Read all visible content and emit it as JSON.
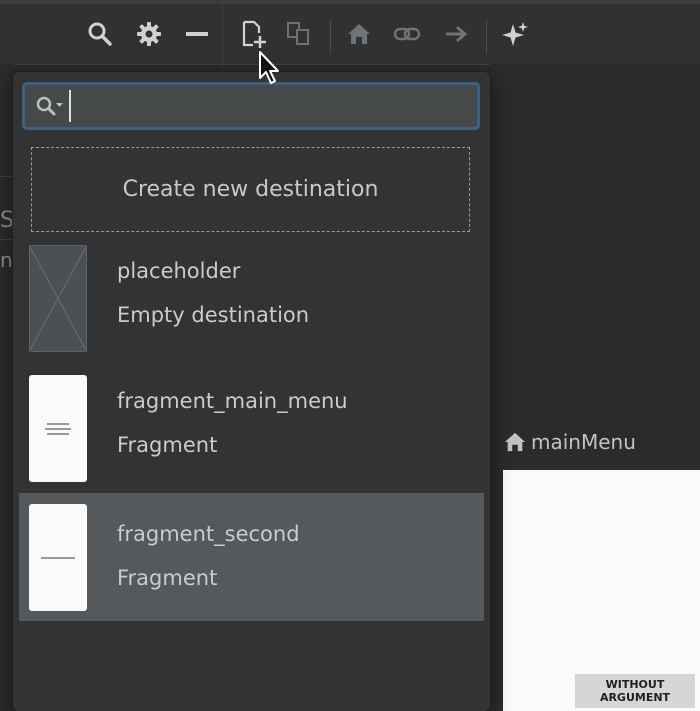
{
  "toolbar": {
    "icons": [
      "search-icon",
      "gear-icon",
      "minus-icon",
      "new-destination-icon",
      "nested-graph-icon",
      "home-icon",
      "link-icon",
      "arrow-right-icon",
      "sparkle-icon"
    ]
  },
  "popup": {
    "search": {
      "value": "",
      "placeholder": ""
    },
    "create_label": "Create new destination",
    "items": [
      {
        "name": "placeholder",
        "type": "Empty destination"
      },
      {
        "name": "fragment_main_menu",
        "type": "Fragment"
      },
      {
        "name": "fragment_second",
        "type": "Fragment"
      }
    ]
  },
  "canvas": {
    "destination_title": "mainMenu",
    "button_label": "WITHOUT ARGUMENT"
  },
  "background": {
    "left_letter_1": "S",
    "left_letter_2": "n"
  },
  "colors": {
    "accent": "#3d6185",
    "selected": "#55595c",
    "popup_bg": "#313335",
    "toolbar_bg": "#2f3133"
  }
}
